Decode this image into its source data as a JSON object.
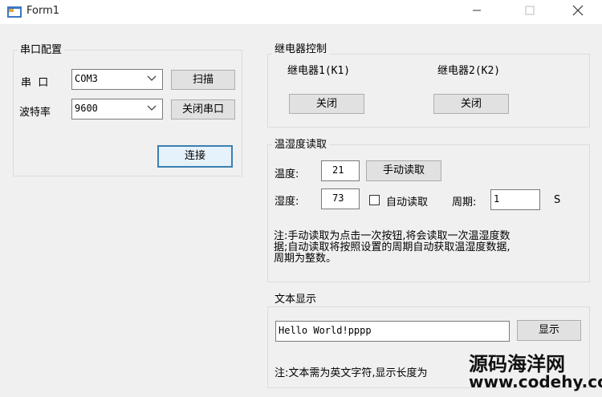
{
  "window": {
    "title": "Form1"
  },
  "serial": {
    "group_title": "串口配置",
    "port_label": "串  口",
    "port_value": "COM3",
    "baud_label": "波特率",
    "baud_value": "9600",
    "scan_button": "扫描",
    "close_port_button": "关闭串口",
    "connect_button": "连接"
  },
  "relay": {
    "group_title": "继电器控制",
    "relay1_label": "继电器1(K1)",
    "relay2_label": "继电器2(K2)",
    "relay1_button": "关闭",
    "relay2_button": "关闭"
  },
  "th": {
    "group_title": "温湿度读取",
    "temp_label": "温度:",
    "temp_value": "21",
    "manual_read_button": "手动读取",
    "humidity_label": "湿度:",
    "humidity_value": "73",
    "auto_read_label": "自动读取",
    "period_label": "周期:",
    "period_value": "1",
    "period_unit": "S",
    "note_line1": "注:手动读取为点击一次按钮,将会读取一次温湿度数",
    "note_line2": "据;自动读取将按照设置的周期自动获取温湿度数据,",
    "note_line3": "周期为整数。"
  },
  "text_display": {
    "group_title": "文本显示",
    "text_value": "Hello World!pppp",
    "show_button": "显示",
    "note": "注:文本需为英文字符,显示长度为"
  },
  "watermark": {
    "line1": "源码海洋网",
    "line2": "www.codehy.com"
  }
}
